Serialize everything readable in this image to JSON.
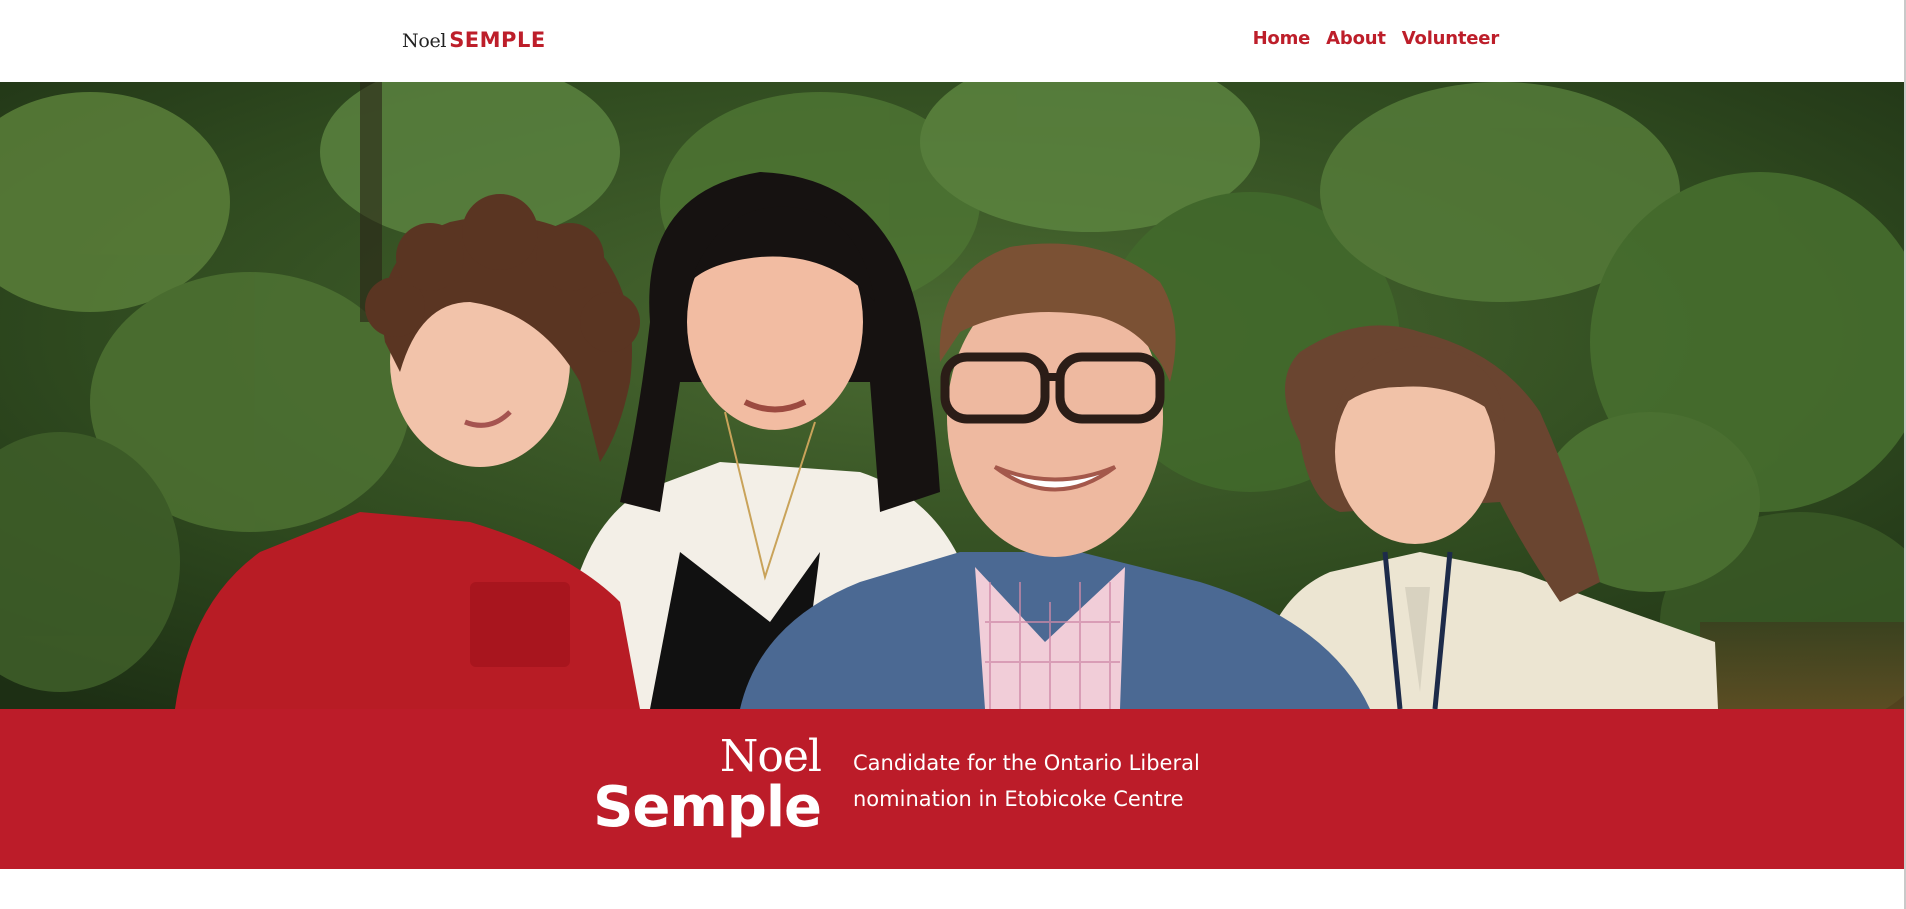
{
  "header": {
    "logo_first": "Noel",
    "logo_last": "SEMPLE",
    "nav": [
      {
        "label": "Home"
      },
      {
        "label": "About"
      },
      {
        "label": "Volunteer"
      }
    ]
  },
  "hero": {
    "image": "family-photo"
  },
  "banner": {
    "first_name": "Noel",
    "last_name": "Semple",
    "tagline": "Candidate for the Ontario Liberal nomination in Etobicoke Centre"
  },
  "colors": {
    "brand_red": "#bc1c29",
    "header_bg": "#ffffff"
  }
}
